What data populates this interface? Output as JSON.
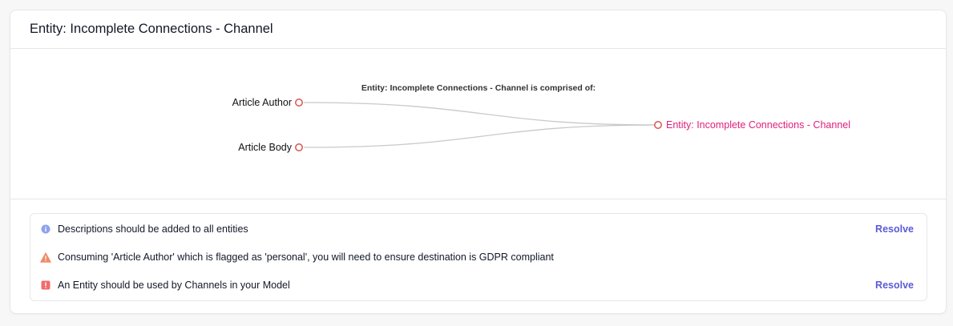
{
  "card": {
    "title": "Entity: Incomplete Connections - Channel"
  },
  "diagram": {
    "caption": "Entity: Incomplete Connections - Channel is comprised of:",
    "sources": [
      {
        "label": "Article Author"
      },
      {
        "label": "Article Body"
      }
    ],
    "target": {
      "label": "Entity: Incomplete Connections - Channel"
    },
    "colors": {
      "node_stroke": "#d9534f",
      "link_stroke": "#c9c9c9",
      "target_text": "#e0217a"
    }
  },
  "issues": [
    {
      "severity": "info",
      "icon": "info-icon",
      "text": "Descriptions should be added to all entities",
      "action": "Resolve"
    },
    {
      "severity": "warning",
      "icon": "warning-icon",
      "text": "Consuming 'Article Author' which is flagged as 'personal', you will need to ensure destination is GDPR compliant",
      "action": ""
    },
    {
      "severity": "error",
      "icon": "error-icon",
      "text": "An Entity should be used by Channels in your Model",
      "action": "Resolve"
    }
  ],
  "colors": {
    "accent": "#5b5bd6",
    "info": "#8ea2f0",
    "warning": "#f08c6a",
    "error": "#f26b6b"
  }
}
